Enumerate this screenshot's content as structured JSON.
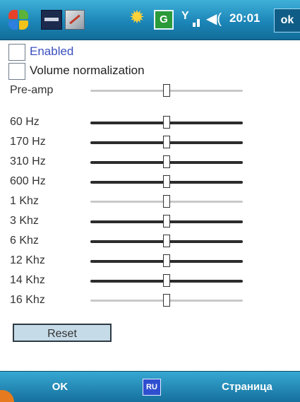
{
  "statusbar": {
    "time": "20:01",
    "ok_label": "ok",
    "g_label": "G",
    "signal_glyph": "Y",
    "volume_glyph": "◀(",
    "icons": [
      "windows-start-icon",
      "app-icon",
      "notes-icon",
      "notification-sun-icon",
      "g-network-icon",
      "signal-icon",
      "volume-icon"
    ]
  },
  "options": {
    "enabled_label": "Enabled",
    "volume_normalization_label": "Volume normalization",
    "enabled_checked": false,
    "volume_normalization_checked": false
  },
  "preamp": {
    "label": "Pre-amp",
    "level": 0.5
  },
  "bands": [
    {
      "label": "60 Hz",
      "level": 0.5
    },
    {
      "label": "170 Hz",
      "level": 0.5
    },
    {
      "label": "310 Hz",
      "level": 0.5
    },
    {
      "label": "600 Hz",
      "level": 0.5
    },
    {
      "label": "1 Khz",
      "level": 0.5
    },
    {
      "label": "3 Khz",
      "level": 0.5
    },
    {
      "label": "6 Khz",
      "level": 0.5
    },
    {
      "label": "12 Khz",
      "level": 0.5
    },
    {
      "label": "14 Khz",
      "level": 0.5
    },
    {
      "label": "16 Khz",
      "level": 0.5
    }
  ],
  "reset_label": "Reset",
  "softkeys": {
    "left": "OK",
    "language": "RU",
    "right": "Страница"
  },
  "colors": {
    "bar_top": "#3fb0d8",
    "bar_bottom": "#126c98",
    "enabled_text": "#3b4fc0",
    "reset_bg": "#c6dbe8"
  }
}
